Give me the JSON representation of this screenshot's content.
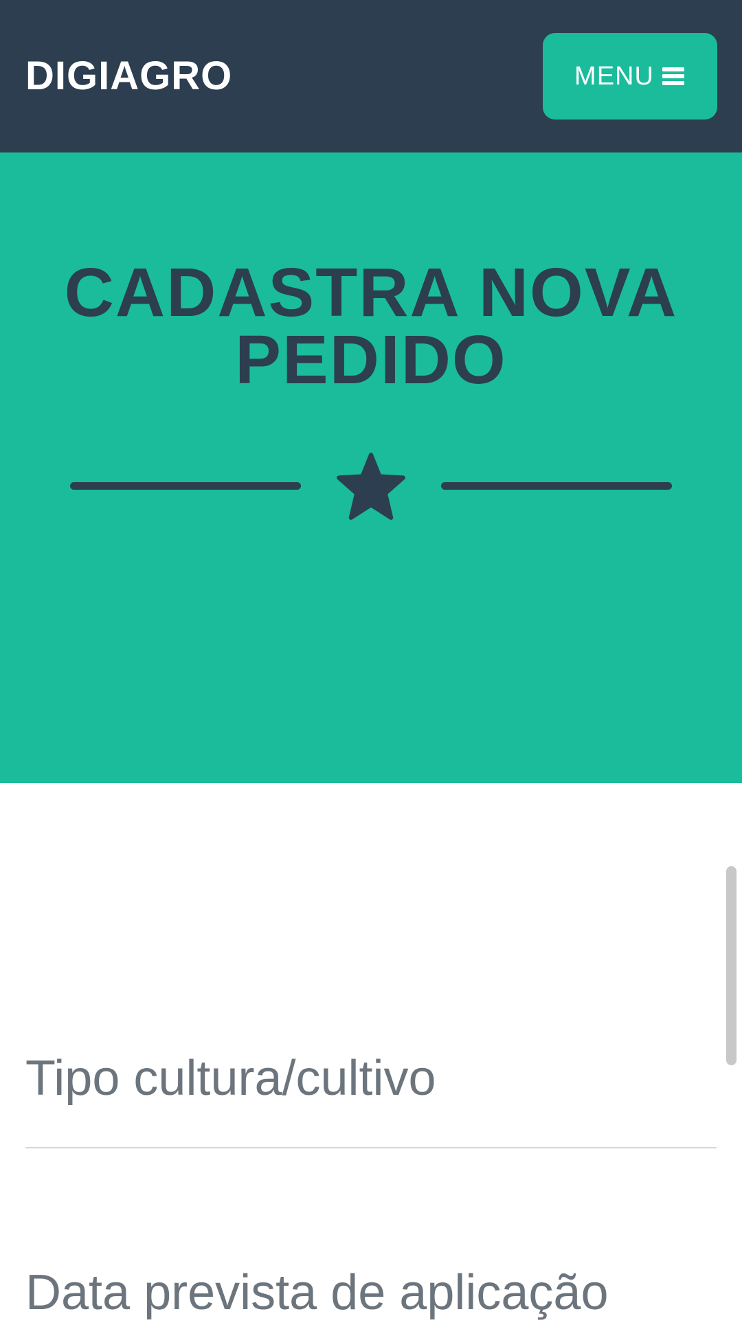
{
  "navbar": {
    "brand": "DIGIAGRO",
    "menu_label": "MENU",
    "menu_icon": "bars-icon",
    "background_color": "#2c3e50"
  },
  "masthead": {
    "title_line_1": "CADASTRA NOVA",
    "title_line_2": "PEDIDO",
    "divider_icon": "star-icon",
    "background_color": "#1abc9c",
    "title_color": "#2c3e50"
  },
  "form": {
    "fields": [
      {
        "placeholder": "Tipo cultura/cultivo",
        "value": ""
      },
      {
        "placeholder": "Data prevista de aplicação",
        "value": ""
      }
    ],
    "text_color": "#6c757d"
  }
}
